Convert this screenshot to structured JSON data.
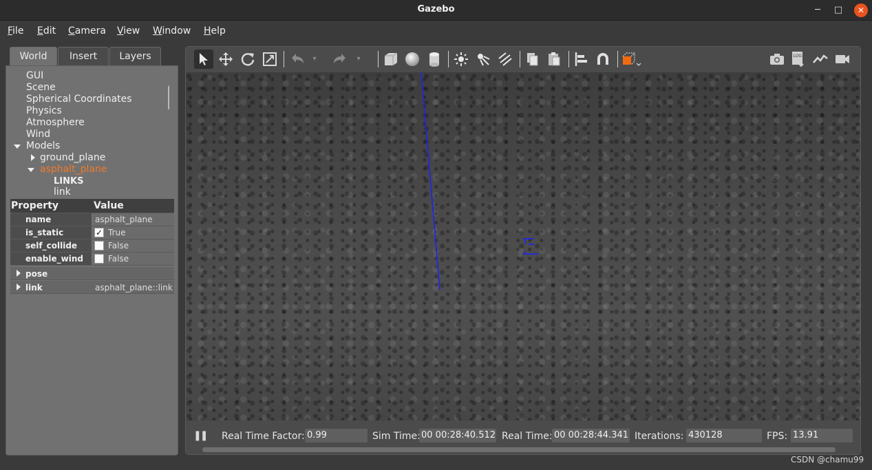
{
  "window": {
    "title": "Gazebo",
    "min_label": "─",
    "max_label": "□",
    "close_label": "✕"
  },
  "menu": [
    {
      "first": "F",
      "rest": "ile"
    },
    {
      "first": "E",
      "rest": "dit"
    },
    {
      "first": "C",
      "rest": "amera"
    },
    {
      "first": "V",
      "rest": "iew"
    },
    {
      "first": "W",
      "rest": "indow"
    },
    {
      "first": "H",
      "rest": "elp"
    }
  ],
  "left_panel": {
    "tabs": [
      "World",
      "Insert",
      "Layers"
    ],
    "tree": {
      "gui": "GUI",
      "scene": "Scene",
      "spherical": "Spherical Coordinates",
      "physics": "Physics",
      "atmosphere": "Atmosphere",
      "wind": "Wind",
      "models": "Models",
      "ground_plane": "ground_plane",
      "asphalt_plane": "asphalt_plane",
      "links": "LINKS",
      "link": "link"
    },
    "properties": {
      "header_property": "Property",
      "header_value": "Value",
      "name_key": "name",
      "name_val": "asphalt_plane",
      "is_static_key": "is_static",
      "is_static_val": "True",
      "self_collide_key": "self_collide",
      "self_collide_val": "False",
      "enable_wind_key": "enable_wind",
      "enable_wind_val": "False",
      "pose_key": "pose",
      "link_key": "link",
      "link_val": "asphalt_plane::link",
      "checkmark": "✓"
    }
  },
  "toolbar": {
    "icons": [
      "select-arrow",
      "translate",
      "rotate",
      "scale",
      "undo",
      "redo",
      "box",
      "sphere",
      "cylinder",
      "point-light",
      "spot-light",
      "directional-light",
      "copy",
      "paste",
      "align",
      "snap",
      "view-angle",
      "screenshot",
      "log",
      "plot",
      "video"
    ]
  },
  "status": {
    "pause_label": "❚❚",
    "rtf_label": "Real Time Factor:",
    "rtf_value": "0.99",
    "sim_label": "Sim Time:",
    "sim_value": "00 00:28:40.512",
    "real_label": "Real Time:",
    "real_value": "00 00:28:44.341",
    "iter_label": "Iterations:",
    "iter_value": "430128",
    "fps_label": "FPS:",
    "fps_value": "13.91"
  },
  "watermark": "CSDN @chamu99",
  "colors": {
    "accent": "#f07a2a",
    "axis_blue": "#1a22ff",
    "orange_cube": "#f26a10"
  }
}
